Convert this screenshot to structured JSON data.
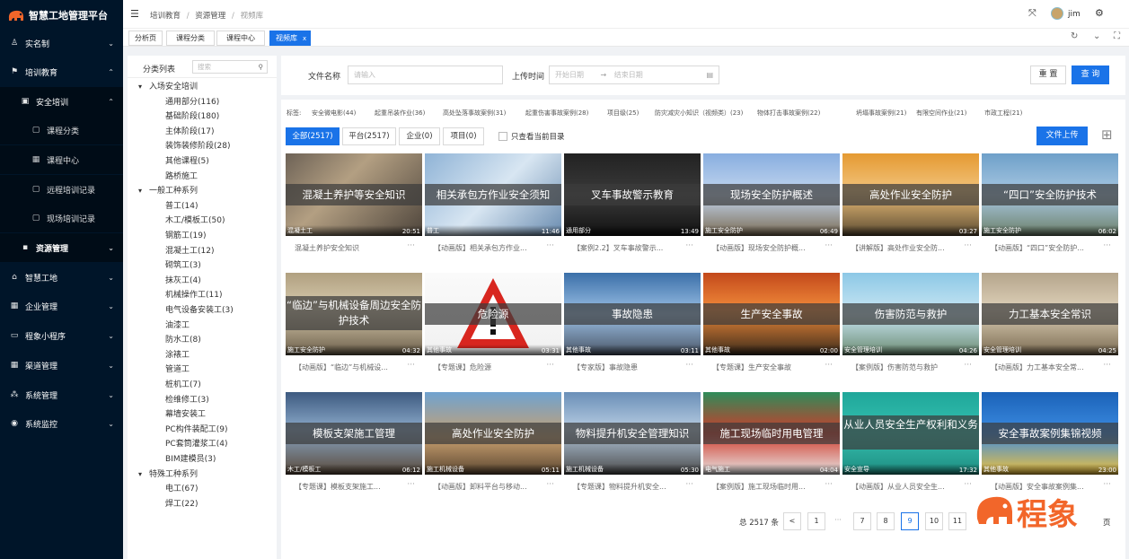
{
  "brand": {
    "title": "智慧工地管理平台"
  },
  "sidebar": {
    "m_realname": "实名制",
    "m_training": "培训教育",
    "m_safety": "安全培训",
    "m_course_cat": "课程分类",
    "m_course_center": "课程中心",
    "m_remote": "远程培训记录",
    "m_onsite": "现场培训记录",
    "m_resource": "资源管理",
    "m_smartsite": "智慧工地",
    "m_enterprise": "企业管理",
    "m_miniapp": "程象小程序",
    "m_channel": "渠道管理",
    "m_system": "系统管理",
    "m_monitor": "系统监控"
  },
  "header": {
    "bc1": "培训教育",
    "bc2": "资源管理",
    "bc3": "视频库",
    "sep": "/",
    "user": "jim"
  },
  "tabs": {
    "t1": "分析页",
    "t2": "课程分类",
    "t3": "课程中心",
    "t4": "视频库",
    "close": "x"
  },
  "catpanel": {
    "title": "分类列表",
    "search_placeholder": "搜索",
    "g1": "入场安全培训",
    "g1items": [
      "通用部分(116)",
      "基础阶段(180)",
      "主体阶段(17)",
      "装饰装修阶段(28)",
      "其他课程(5)",
      "路桥施工"
    ],
    "g2": "一般工种系列",
    "g2items": [
      "普工(14)",
      "木工/模板工(50)",
      "钢筋工(19)",
      "混凝土工(12)",
      "砌筑工(3)",
      "抹灰工(4)",
      "机械操作工(11)",
      "电气设备安装工(3)",
      "油漆工",
      "防水工(8)",
      "涂裱工",
      "管道工",
      "桩机工(7)",
      "检维修工(3)",
      "幕墙安装工",
      "PC构件装配工(9)",
      "PC套筒灌浆工(4)",
      "BIM建模员(3)"
    ],
    "g3": "特殊工种系列",
    "g3items": [
      "电工(67)",
      "焊工(22)"
    ]
  },
  "filter": {
    "name_label": "文件名称",
    "name_placeholder": "请输入",
    "time_label": "上传时间",
    "start_placeholder": "开始日期",
    "arrow": "→",
    "end_placeholder": "结束日期",
    "reset": "重 置",
    "query": "查 询"
  },
  "tags": {
    "label": "标签:",
    "items": [
      "安全微电影(44)",
      "起重吊装作业(36)",
      "高处坠落事故案例(31)",
      "起重伤害事故案例(28)",
      "项目级(25)",
      "防灾减灾小知识（视频类）(23)",
      "物体打击事故案例(22)",
      "坍塌事故案例(21)",
      "有限空间作业(21)",
      "市政工程(21)"
    ]
  },
  "subtabs": {
    "all": "全部(2517)",
    "platform": "平台(2517)",
    "enterprise": "企业(0)",
    "project": "项目(0)",
    "only_current": "只查看当前目录",
    "upload": "文件上传"
  },
  "cards": [
    {
      "overlay": "混凝土养护等安全知识",
      "category": "混凝土工",
      "duration": "20:51",
      "title": "混凝土养护安全知识"
    },
    {
      "overlay": "相关承包方作业安全须知",
      "category": "普工",
      "duration": "11:46",
      "title": "【动画版】相关承包方作业..."
    },
    {
      "overlay": "叉车事故警示教育",
      "category": "通用部分",
      "duration": "13:49",
      "title": "【案例2.2】叉车事故警示..."
    },
    {
      "overlay": "现场安全防护概述",
      "category": "施工安全防护",
      "duration": "06:49",
      "title": "【动画版】现场安全防护概..."
    },
    {
      "overlay": "高处作业安全防护",
      "category": "",
      "duration": "03:27",
      "title": "【讲解版】高处作业安全防..."
    },
    {
      "overlay": "“四口”安全防护技术",
      "category": "施工安全防护",
      "duration": "06:02",
      "title": "【动画版】“四口”安全防护..."
    },
    {
      "overlay": "“临边”与机械设备周边安全防护技术",
      "category": "施工安全防护",
      "duration": "04:32",
      "title": "【动画版】“临边”与机械设..."
    },
    {
      "overlay": "危险源",
      "category": "其他事故",
      "duration": "03:31",
      "title": "【专题课】危险源"
    },
    {
      "overlay": "事故隐患",
      "category": "其他事故",
      "duration": "03:11",
      "title": "【专家版】事故隐患"
    },
    {
      "overlay": "生产安全事故",
      "category": "其他事故",
      "duration": "02:00",
      "title": "【专题课】生产安全事故"
    },
    {
      "overlay": "伤害防范与救护",
      "category": "安全管理培训",
      "duration": "04:26",
      "title": "【案例版】伤害防范与救护"
    },
    {
      "overlay": "力工基本安全常识",
      "category": "安全管理培训",
      "duration": "04:25",
      "title": "【动画版】力工基本安全常..."
    },
    {
      "overlay": "模板支架施工管理",
      "category": "木工/模板工",
      "duration": "06:12",
      "title": "【专题课】模板支架施工..."
    },
    {
      "overlay": "高处作业安全防护",
      "category": "施工机械设备",
      "duration": "05:11",
      "title": "【动画版】卸料平台与移动..."
    },
    {
      "overlay": "物料提升机安全管理知识",
      "category": "施工机械设备",
      "duration": "05:30",
      "title": "【专题课】物料提升机安全..."
    },
    {
      "overlay": "施工现场临时用电管理",
      "category": "电气施工",
      "duration": "04:04",
      "title": "【案例版】施工现场临时用..."
    },
    {
      "overlay": "从业人员安全生产权利和义务",
      "category": "安全宣导",
      "duration": "17:32",
      "title": "【动画版】从业人员安全生..."
    },
    {
      "overlay": "安全事故案例集锦视频",
      "category": "其他事故",
      "duration": "23:00",
      "title": "【动画版】安全事故案例集..."
    }
  ],
  "pagination": {
    "total": "总 2517 条",
    "prev": "<",
    "p1": "1",
    "ellipsis": "···",
    "p7": "7",
    "p8": "8",
    "p9": "9",
    "p10": "10",
    "p11": "11",
    "page_suffix": "页"
  },
  "watermark": {
    "text": "程象"
  },
  "colors": {
    "primary": "#1a73e8",
    "sider": "#001529",
    "accent": "#f2662a"
  }
}
